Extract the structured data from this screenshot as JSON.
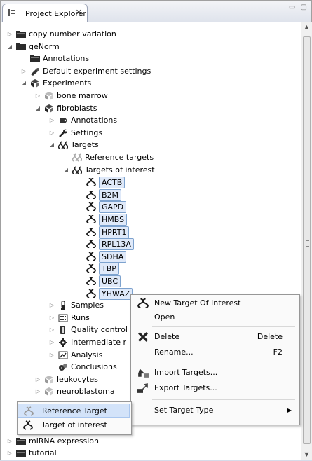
{
  "view": {
    "title": "Project Explorer",
    "close_label": "✕",
    "controls": "▭ ▢"
  },
  "tree": {
    "rows": [
      {
        "label": "copy number variation",
        "indent": 0,
        "twisty": "▷",
        "icon": "folder-icon"
      },
      {
        "label": "geNorm",
        "indent": 0,
        "twisty": "◢",
        "icon": "folder-icon"
      },
      {
        "label": "Annotations",
        "indent": 1,
        "twisty": "",
        "icon": "folder-icon"
      },
      {
        "label": "Default experiment settings",
        "indent": 1,
        "twisty": "▷",
        "icon": "settings-icon"
      },
      {
        "label": "Experiments",
        "indent": 1,
        "twisty": "◢",
        "icon": "experiments-icon"
      },
      {
        "label": "bone marrow",
        "indent": 2,
        "twisty": "▷",
        "icon": "experiment-gray-icon"
      },
      {
        "label": "fibroblasts",
        "indent": 2,
        "twisty": "◢",
        "icon": "experiment-icon"
      },
      {
        "label": "Annotations",
        "indent": 3,
        "twisty": "▷",
        "icon": "annotations-icon"
      },
      {
        "label": "Settings",
        "indent": 3,
        "twisty": "▷",
        "icon": "wrench-icon"
      },
      {
        "label": "Targets",
        "indent": 3,
        "twisty": "◢",
        "icon": "targets-icon"
      },
      {
        "label": "Reference targets",
        "indent": 4,
        "twisty": "",
        "icon": "reference-targets-icon"
      },
      {
        "label": "Targets of interest",
        "indent": 4,
        "twisty": "◢",
        "icon": "targets-of-interest-icon"
      },
      {
        "label": "ACTB",
        "indent": 5,
        "twisty": "",
        "icon": "target-icon",
        "selected": true
      },
      {
        "label": "B2M",
        "indent": 5,
        "twisty": "",
        "icon": "target-icon",
        "selected": true
      },
      {
        "label": "GAPD",
        "indent": 5,
        "twisty": "",
        "icon": "target-icon",
        "selected": true
      },
      {
        "label": "HMBS",
        "indent": 5,
        "twisty": "",
        "icon": "target-icon",
        "selected": true
      },
      {
        "label": "HPRT1",
        "indent": 5,
        "twisty": "",
        "icon": "target-icon",
        "selected": true
      },
      {
        "label": "RPL13A",
        "indent": 5,
        "twisty": "",
        "icon": "target-icon",
        "selected": true
      },
      {
        "label": "SDHA",
        "indent": 5,
        "twisty": "",
        "icon": "target-icon",
        "selected": true
      },
      {
        "label": "TBP",
        "indent": 5,
        "twisty": "",
        "icon": "target-icon",
        "selected": true
      },
      {
        "label": "UBC",
        "indent": 5,
        "twisty": "",
        "icon": "target-icon",
        "selected": true
      },
      {
        "label": "YHWAZ",
        "indent": 5,
        "twisty": "",
        "icon": "target-icon",
        "selected": true
      },
      {
        "label": "Samples",
        "indent": 3,
        "twisty": "▷",
        "icon": "samples-icon"
      },
      {
        "label": "Runs",
        "indent": 3,
        "twisty": "▷",
        "icon": "runs-icon"
      },
      {
        "label": "Quality control",
        "indent": 3,
        "twisty": "▷",
        "icon": "quality-control-icon"
      },
      {
        "label": "Intermediate r",
        "indent": 3,
        "twisty": "▷",
        "icon": "intermediate-results-icon"
      },
      {
        "label": "Analysis",
        "indent": 3,
        "twisty": "▷",
        "icon": "analysis-icon"
      },
      {
        "label": "Conclusions",
        "indent": 3,
        "twisty": "",
        "icon": "conclusions-icon"
      },
      {
        "label": "leukocytes",
        "indent": 2,
        "twisty": "▷",
        "icon": "experiment-gray-icon"
      },
      {
        "label": "neuroblastoma",
        "indent": 2,
        "twisty": "▷",
        "icon": "experiment-gray-icon"
      },
      {
        "label": "",
        "indent": 0,
        "twisty": "",
        "icon": ""
      },
      {
        "label": "",
        "indent": 0,
        "twisty": "",
        "icon": ""
      },
      {
        "label": "",
        "indent": 0,
        "twisty": "",
        "icon": ""
      },
      {
        "label": "miRNA expression",
        "indent": 0,
        "twisty": "▷",
        "icon": "folder-icon"
      },
      {
        "label": "tutorial",
        "indent": 0,
        "twisty": "▷",
        "icon": "folder-icon"
      }
    ]
  },
  "context_menu": {
    "items": [
      {
        "label": "New Target Of Interest",
        "shortcut": "",
        "icon": "new-target-icon"
      },
      {
        "label": "Open",
        "shortcut": "",
        "icon": ""
      },
      {
        "label": "Delete",
        "shortcut": "Delete",
        "icon": "delete-icon"
      },
      {
        "label": "Rename...",
        "shortcut": "F2",
        "icon": ""
      },
      {
        "label": "Import Targets...",
        "shortcut": "",
        "icon": "import-icon"
      },
      {
        "label": "Export Targets...",
        "shortcut": "",
        "icon": "export-icon"
      },
      {
        "label": "Set Target Type",
        "shortcut": "",
        "icon": "",
        "submenu": true
      }
    ]
  },
  "submenu": {
    "items": [
      {
        "label": "Reference Target",
        "icon": "reference-target-icon"
      },
      {
        "label": "Target of interest",
        "icon": "target-of-interest-icon"
      }
    ]
  }
}
